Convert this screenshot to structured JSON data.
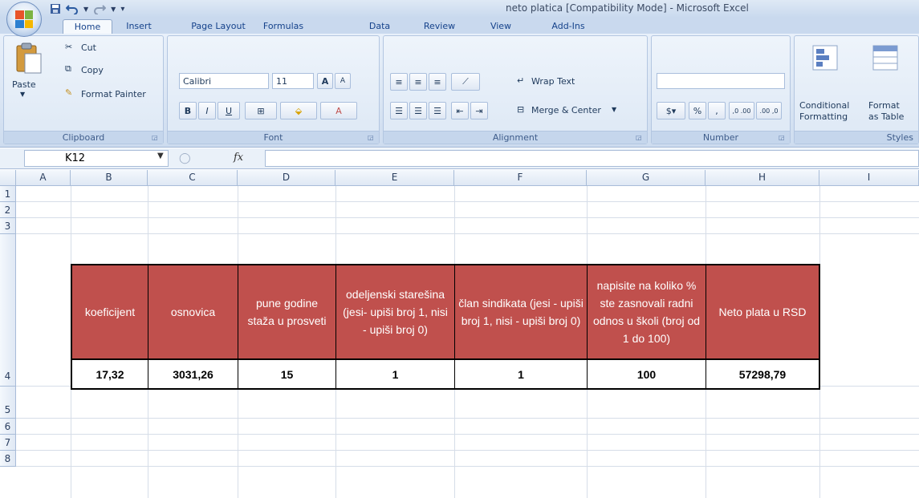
{
  "window": {
    "title": "neto platica  [Compatibility Mode] - Microsoft Excel"
  },
  "tabs": [
    "Home",
    "Insert",
    "Page Layout",
    "Formulas",
    "Data",
    "Review",
    "View",
    "Add-Ins"
  ],
  "ribbon": {
    "clipboard": {
      "paste": "Paste",
      "cut": "Cut",
      "copy": "Copy",
      "format_painter": "Format Painter",
      "label": "Clipboard"
    },
    "font": {
      "name": "Calibri",
      "size": "11",
      "grow": "A",
      "shrink": "A",
      "bold": "B",
      "italic": "I",
      "underline": "U",
      "font_color_glyph": "A",
      "label": "Font"
    },
    "alignment": {
      "wrap_text": "Wrap Text",
      "merge_center": "Merge & Center",
      "label": "Alignment"
    },
    "number": {
      "format_value": "",
      "percent": "%",
      "comma": ",",
      "inc_decimal": ",0 .00",
      "dec_decimal": ".00 ,0",
      "label": "Number"
    },
    "styles": {
      "conditional": "Conditional",
      "formatting": "Formatting",
      "format": "Format",
      "as_table": "as Table",
      "label": "Styles"
    }
  },
  "formula_bar": {
    "name_box": "K12",
    "fx": "fx",
    "content": ""
  },
  "sheet": {
    "columns": [
      "A",
      "B",
      "C",
      "D",
      "E",
      "F",
      "G",
      "H",
      "I"
    ],
    "rows": [
      "1",
      "2",
      "3",
      "4",
      "5",
      "6",
      "7",
      "8"
    ],
    "headers": [
      "koeficijent",
      "osnovica",
      "pune godine staža u prosveti",
      "odeljenski starešina (jesi- upiši  broj 1, nisi - upiši broj 0)",
      "član sindikata (jesi - upiši  broj 1, nisi - upiši broj 0)",
      "napisite na koliko % ste zasnovali radni odnos u školi (broj od 1 do 100)",
      "Neto plata u RSD"
    ],
    "values": [
      "17,32",
      "3031,26",
      "15",
      "1",
      "1",
      "100",
      "57298,79"
    ]
  },
  "colors": {
    "header_fill": "#c0504d",
    "header_text": "#ffffff",
    "ribbon_bg": "#dbe6f4"
  }
}
